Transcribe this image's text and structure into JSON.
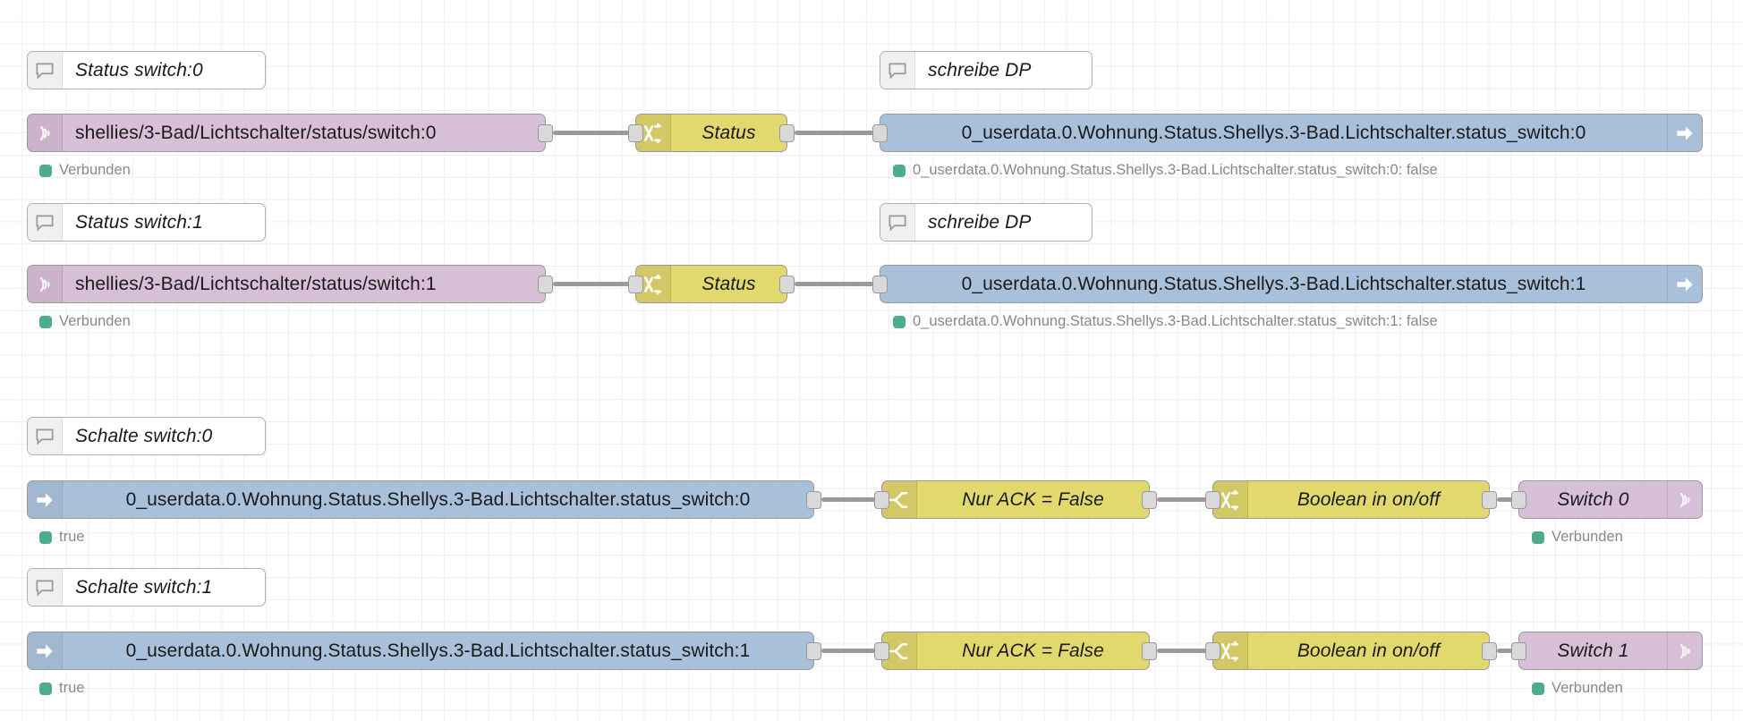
{
  "app": {
    "name": "Node-RED Flow Editor",
    "canvas_background": "#ffffff",
    "grid_color": "#eeeeee"
  },
  "colors": {
    "mqtt_node": "#d8bfd8",
    "function_node": "#e2d96e",
    "iobroker_node": "#a9c0da",
    "comment_node": "#ffffff",
    "status_dot_green": "#4ead89",
    "wire": "#9a9a9a",
    "port": "#d9d9d9"
  },
  "groups": [
    {
      "id": "status-switch-0",
      "comment": {
        "label": "Status switch:0",
        "icon": "comment-icon"
      },
      "comment2": {
        "label": "schreibe DP",
        "icon": "comment-icon"
      },
      "mqtt_in": {
        "label": "shellies/3-Bad/Lichtschalter/status/switch:0",
        "icon": "mqtt-icon",
        "status": "Verbunden"
      },
      "function": {
        "label": "Status",
        "icon": "function-icon"
      },
      "iob_out": {
        "label": "0_userdata.0.Wohnung.Status.Shellys.3-Bad.Lichtschalter.status_switch:0",
        "icon": "arrow-right-icon",
        "status": "0_userdata.0.Wohnung.Status.Shellys.3-Bad.Lichtschalter.status_switch:0: false"
      }
    },
    {
      "id": "status-switch-1",
      "comment": {
        "label": "Status switch:1",
        "icon": "comment-icon"
      },
      "comment2": {
        "label": "schreibe DP",
        "icon": "comment-icon"
      },
      "mqtt_in": {
        "label": "shellies/3-Bad/Lichtschalter/status/switch:1",
        "icon": "mqtt-icon",
        "status": "Verbunden"
      },
      "function": {
        "label": "Status",
        "icon": "function-icon"
      },
      "iob_out": {
        "label": "0_userdata.0.Wohnung.Status.Shellys.3-Bad.Lichtschalter.status_switch:1",
        "icon": "arrow-right-icon",
        "status": "0_userdata.0.Wohnung.Status.Shellys.3-Bad.Lichtschalter.status_switch:1: false"
      }
    },
    {
      "id": "schalte-switch-0",
      "comment": {
        "label": "Schalte switch:0",
        "icon": "comment-icon"
      },
      "iob_in": {
        "label": "0_userdata.0.Wohnung.Status.Shellys.3-Bad.Lichtschalter.status_switch:0",
        "icon": "arrow-right-icon",
        "status": "true"
      },
      "switch": {
        "label": "Nur ACK = False",
        "icon": "switch-icon"
      },
      "function": {
        "label": "Boolean in on/off",
        "icon": "function-icon"
      },
      "mqtt_out": {
        "label": "Switch 0",
        "icon": "mqtt-icon",
        "status": "Verbunden"
      }
    },
    {
      "id": "schalte-switch-1",
      "comment": {
        "label": "Schalte switch:1",
        "icon": "comment-icon"
      },
      "iob_in": {
        "label": "0_userdata.0.Wohnung.Status.Shellys.3-Bad.Lichtschalter.status_switch:1",
        "icon": "arrow-right-icon",
        "status": "true"
      },
      "switch": {
        "label": "Nur ACK = False",
        "icon": "switch-icon"
      },
      "function": {
        "label": "Boolean in on/off",
        "icon": "function-icon"
      },
      "mqtt_out": {
        "label": "Switch 1",
        "icon": "mqtt-icon",
        "status": "Verbunden"
      }
    }
  ]
}
